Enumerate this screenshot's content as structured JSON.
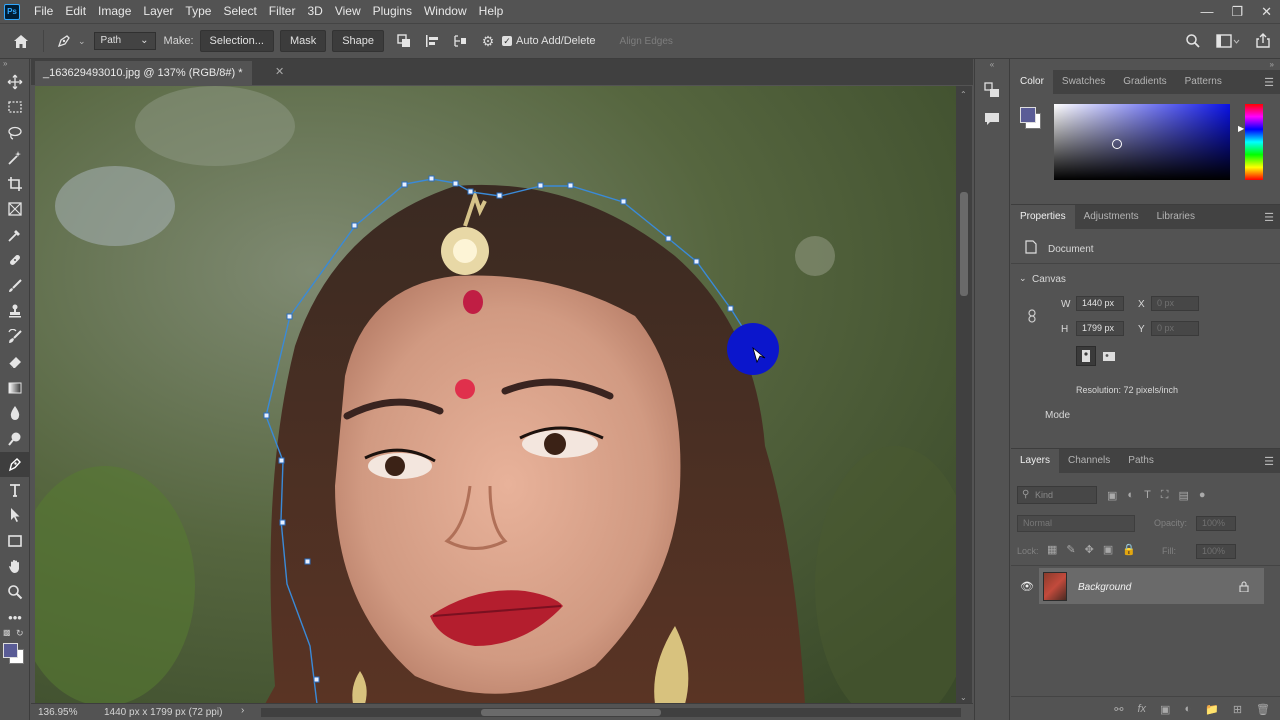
{
  "app": {
    "logo": "Ps"
  },
  "menu": [
    "File",
    "Edit",
    "Image",
    "Layer",
    "Type",
    "Select",
    "Filter",
    "3D",
    "View",
    "Plugins",
    "Window",
    "Help"
  ],
  "options": {
    "path_mode": "Path",
    "make_label": "Make:",
    "selection_button": "Selection...",
    "mask_button": "Mask",
    "shape_button": "Shape",
    "auto_add_delete": "Auto Add/Delete",
    "align_edges": "Align Edges"
  },
  "document": {
    "tab_title": "_163629493010.jpg @ 137% (RGB/8#) *",
    "zoom_status": "136.95%",
    "size_status": "1440 px x 1799 px (72 ppi)"
  },
  "color_panel": {
    "tabs": [
      "Color",
      "Swatches",
      "Gradients",
      "Patterns"
    ],
    "active_tab": "Color",
    "foreground_color": "#5a5c96",
    "background_color": "#ffffff",
    "field_hue_color": "#0a12e6"
  },
  "properties_panel": {
    "tabs": [
      "Properties",
      "Adjustments",
      "Libraries"
    ],
    "document_label": "Document",
    "canvas_header": "Canvas",
    "w_label": "W",
    "w_value": "1440 px",
    "h_label": "H",
    "h_value": "1799 px",
    "x_label": "X",
    "x_value": "0 px",
    "y_label": "Y",
    "y_value": "0 px",
    "resolution": "Resolution: 72 pixels/inch",
    "mode_label": "Mode"
  },
  "layers_panel": {
    "tabs": [
      "Layers",
      "Channels",
      "Paths"
    ],
    "kind_placeholder": "Kind",
    "blend_mode": "Normal",
    "opacity_label": "Opacity:",
    "opacity_value": "100%",
    "lock_label": "Lock:",
    "fill_label": "Fill:",
    "fill_value": "100%",
    "layers": [
      {
        "name": "Background",
        "visible": true,
        "locked": true
      }
    ]
  }
}
